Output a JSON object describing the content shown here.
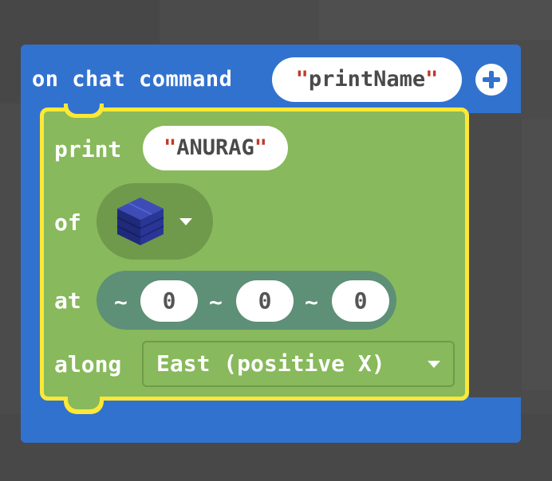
{
  "event_block": {
    "label": "on chat command",
    "command_value": "printName",
    "add_button_icon": "plus-circle-icon",
    "color": "#3272cf"
  },
  "print_block": {
    "label": "print",
    "text_value": "ANURAG",
    "of_label": "of",
    "block_icon": "blue-block-icon",
    "at_label": "at",
    "position": [
      {
        "prefix": "~",
        "value": "0"
      },
      {
        "prefix": "~",
        "value": "0"
      },
      {
        "prefix": "~",
        "value": "0"
      }
    ],
    "along_label": "along",
    "direction_value": "East (positive X)",
    "color": "#88b95c",
    "highlight_color": "#ffe835"
  }
}
